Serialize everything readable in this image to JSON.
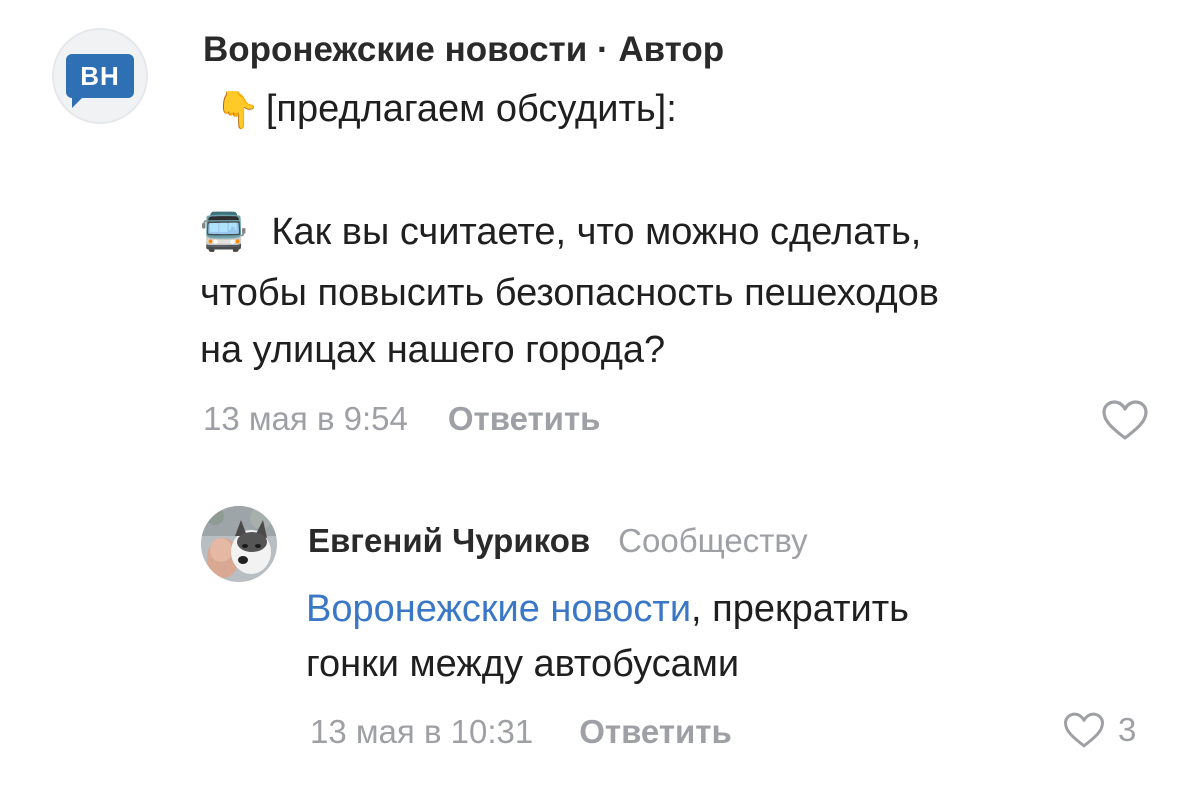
{
  "comment_main": {
    "avatar_text": "ВН",
    "author": "Воронежские новости",
    "separator": "·",
    "role": "Автор",
    "line1_text": "[предлагаем обсудить]:",
    "line2_text": "Как вы считаете, что можно сделать,",
    "line3_text": "чтобы повысить безопасность пешеходов",
    "line4_text": "на улицах нашего города?",
    "date": "13 мая в 9:54",
    "reply_label": "Ответить"
  },
  "comment_reply": {
    "author": "Евгений Чуриков",
    "to_label": "Сообществу",
    "mention": "Воронежские новости",
    "line1_rest": ", прекратить",
    "line2_text": "гонки между автобусами",
    "date": "13 мая в 10:31",
    "reply_label": "Ответить",
    "like_count": "3"
  },
  "icons": {
    "hand": "backhand-index-pointing-down-icon",
    "bus": "oncoming-bus-icon",
    "heart": "heart-outline-icon"
  },
  "colors": {
    "brand_blue": "#2f6fb4",
    "mention_blue": "#3a77c7",
    "meta_gray": "#9ea0a5"
  }
}
